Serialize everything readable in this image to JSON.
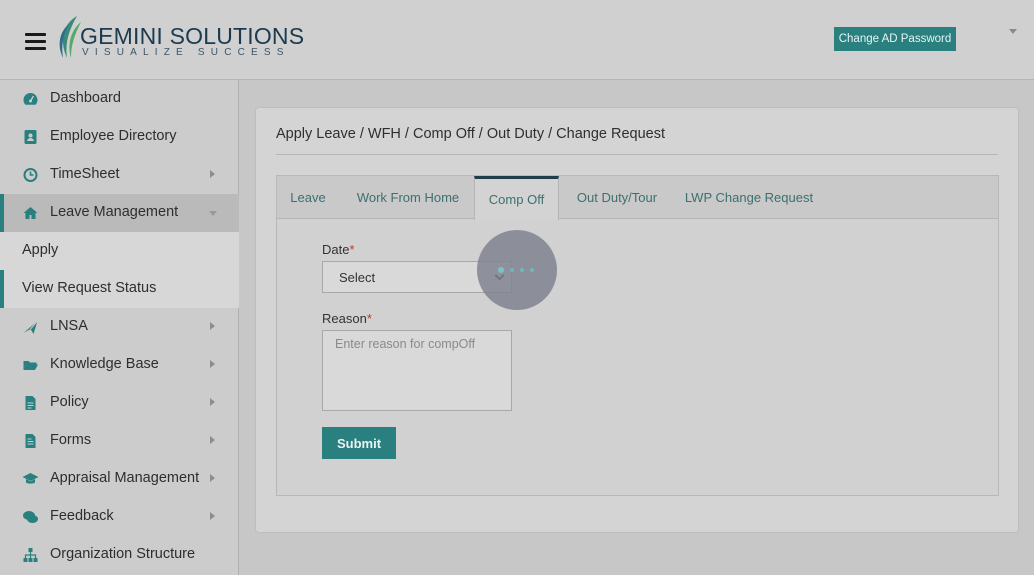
{
  "header": {
    "logo_name": "GEMINI SOLUTIONS",
    "logo_tagline": "VISUALIZE SUCCESS",
    "change_password_label": "Change AD Password"
  },
  "sidebar": {
    "items": [
      {
        "label": "Dashboard",
        "icon": "dashboard-icon"
      },
      {
        "label": "Employee Directory",
        "icon": "address-book-icon"
      },
      {
        "label": "TimeSheet",
        "icon": "clock-icon"
      },
      {
        "label": "Leave Management",
        "icon": "home-icon"
      },
      {
        "label": "LNSA",
        "icon": "paper-plane-icon"
      },
      {
        "label": "Knowledge Base",
        "icon": "folder-open-icon"
      },
      {
        "label": "Policy",
        "icon": "document-icon"
      },
      {
        "label": "Forms",
        "icon": "form-icon"
      },
      {
        "label": "Appraisal Management",
        "icon": "graduation-cap-icon"
      },
      {
        "label": "Feedback",
        "icon": "comments-icon"
      },
      {
        "label": "Organization Structure",
        "icon": "sitemap-icon"
      }
    ],
    "sub_items": [
      {
        "label": "Apply"
      },
      {
        "label": "View Request Status"
      }
    ]
  },
  "main": {
    "title": "Apply Leave / WFH / Comp Off / Out Duty / Change Request",
    "tabs": [
      {
        "label": "Leave"
      },
      {
        "label": "Work From Home"
      },
      {
        "label": "Comp Off"
      },
      {
        "label": "Out Duty/Tour"
      },
      {
        "label": "LWP Change Request"
      }
    ],
    "active_tab": "Comp Off",
    "form": {
      "date_label": "Date",
      "date_value": "Select",
      "reason_label": "Reason",
      "reason_placeholder": "Enter reason for compOff",
      "required_marker": "*",
      "submit_label": "Submit"
    }
  },
  "colors": {
    "accent": "#2a7f7f",
    "required": "#c0392b"
  }
}
